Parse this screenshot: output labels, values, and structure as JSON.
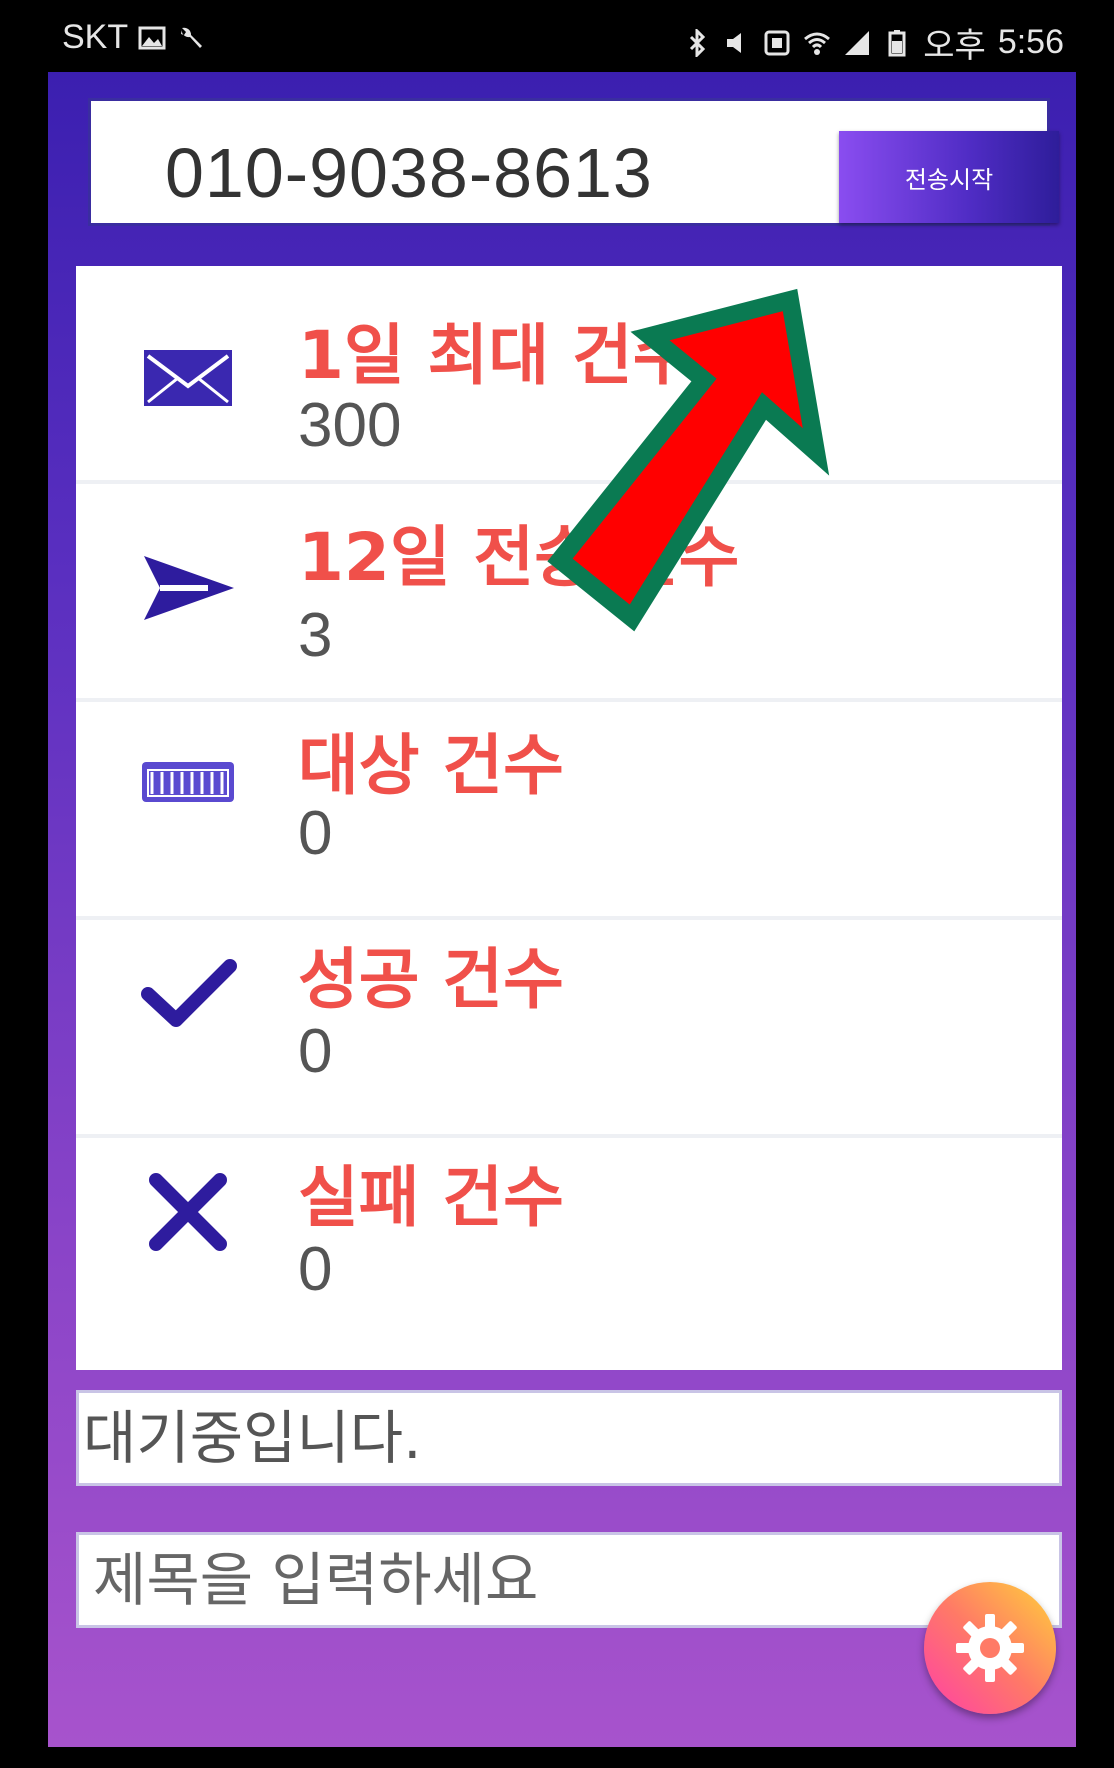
{
  "status_bar": {
    "carrier": "SKT",
    "time_prefix": "오후",
    "time": "5:56"
  },
  "header": {
    "phone_number": "010-9038-8613",
    "send_button_label": "전송시작"
  },
  "stats": [
    {
      "icon": "envelope-icon",
      "label": "1일 최대 건수",
      "value": "300"
    },
    {
      "icon": "send-icon",
      "label": "12일 전송 건수",
      "value": "3"
    },
    {
      "icon": "keyboard-icon",
      "label": "대상 건수",
      "value": "0"
    },
    {
      "icon": "check-icon",
      "label": "성공 건수",
      "value": "0"
    },
    {
      "icon": "close-icon",
      "label": "실패 건수",
      "value": "0"
    }
  ],
  "status_message": "대기중입니다.",
  "subject_input": {
    "placeholder": "제목을 입력하세요"
  },
  "colors": {
    "accent": "#3b1fb0",
    "label_red": "#f0504a",
    "arrow_fill": "#ff0000",
    "arrow_outline": "#0a7a52"
  }
}
